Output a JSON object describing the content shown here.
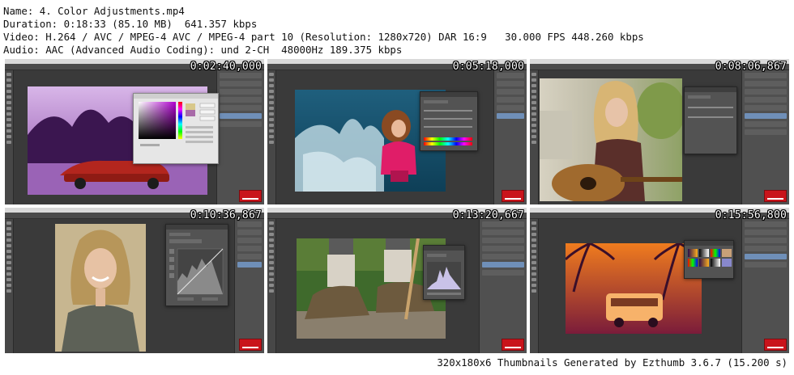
{
  "header": {
    "name": "Name: 4. Color Adjustments.mp4",
    "duration": "Duration: 0:18:33 (85.10 MB)  641.357 kbps",
    "video": "Video: H.264 / AVC / MPEG-4 AVC / MPEG-4 part 10 (Resolution: 1280x720) DAR 16:9   30.000 FPS 448.260 kbps",
    "audio": "Audio: AAC (Advanced Audio Coding): und 2-CH  48000Hz 189.375 kbps"
  },
  "thumbnails": [
    {
      "timestamp": "0:02:40,000",
      "subject": "photoshop-purple-car-color-picker"
    },
    {
      "timestamp": "0:05:18,000",
      "subject": "photoshop-girl-water-splash-hue-saturation"
    },
    {
      "timestamp": "0:08:06,867",
      "subject": "photoshop-woman-guitar-vibrance"
    },
    {
      "timestamp": "0:10:36,867",
      "subject": "photoshop-smiling-woman-curves"
    },
    {
      "timestamp": "0:13:20,667",
      "subject": "photoshop-hiking-boots-levels"
    },
    {
      "timestamp": "0:15:56,800",
      "subject": "photoshop-orange-van-gradient-map"
    }
  ],
  "footer": "320x180x6 Thumbnails Generated by Ezthumb 3.6.7 (15.200 s)"
}
